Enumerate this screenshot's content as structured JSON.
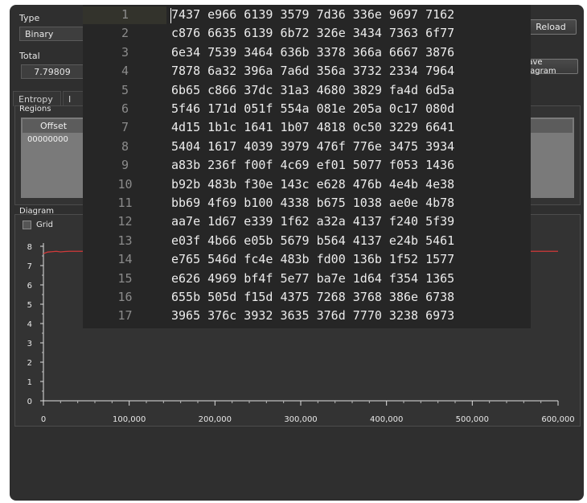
{
  "type_label": "Type",
  "type_value": "Binary",
  "total_label": "Total",
  "total_value": "7.79809",
  "reload_label": "Reload",
  "save_diagram_label": "Save diagram",
  "tabs": [
    "Entropy",
    "I"
  ],
  "regions_label": "Regions",
  "table_header": "Offset",
  "table_row": "00000000",
  "diagram_label": "Diagram",
  "grid_label": "Grid",
  "chart_data": {
    "type": "line",
    "ylim": [
      0,
      8
    ],
    "xlim": [
      0,
      600000
    ],
    "y_ticks": [
      "0",
      "1",
      "2",
      "3",
      "4",
      "5",
      "6",
      "7",
      "8"
    ],
    "x_ticks": [
      "0",
      "100,000",
      "200,000",
      "300,000",
      "400,000",
      "500,000",
      "600,000"
    ],
    "series_color": "#d03a3a",
    "series": [
      {
        "x": [
          0,
          5000,
          10000,
          15000,
          20000,
          25000,
          30000,
          35000,
          600000
        ],
        "y": [
          7.62,
          7.7,
          7.72,
          7.74,
          7.71,
          7.73,
          7.74,
          7.74,
          7.74
        ]
      }
    ],
    "grid": false
  },
  "editor": {
    "line_numbers": [
      "1",
      "2",
      "3",
      "4",
      "5",
      "6",
      "7",
      "8",
      "9",
      "10",
      "11",
      "12",
      "13",
      "14",
      "15",
      "16",
      "17"
    ],
    "lines": [
      "7437 e966 6139 3579 7d36 336e 9697 7162",
      "c876 6635 6139 6b72 326e 3434 7363 6f77",
      "6e34 7539 3464 636b 3378 366a 6667 3876",
      "7878 6a32 396a 7a6d 356a 3732 2334 7964",
      "6b65 c866 37dc 31a3 4680 3829 fa4d 6d5a",
      "5f46 171d 051f 554a 081e 205a 0c17 080d",
      "4d15 1b1c 1641 1b07 4818 0c50 3229 6641",
      "5404 1617 4039 3979 476f 776e 3475 3934",
      "a83b 236f f00f 4c69 ef01 5077 f053 1436",
      "b92b 483b f30e 143c e628 476b 4e4b 4e38",
      "bb69 4f69 b100 4338 b675 1038 ae0e 4b78",
      "aa7e 1d67 e339 1f62 a32a 4137 f240 5f39",
      "e03f 4b66 e05b 5679 b564 4137 e24b 5461",
      "e765 546d fc4e 483b fd00 136b 1f52 1577",
      "e626 4969 bf4f 5e77 ba7e 1d64 f354 1365",
      "655b 505d f15d 4375 7268 3768 386e 6738",
      "3965 376c 3932 3635 376d 7770 3238 6973"
    ]
  }
}
